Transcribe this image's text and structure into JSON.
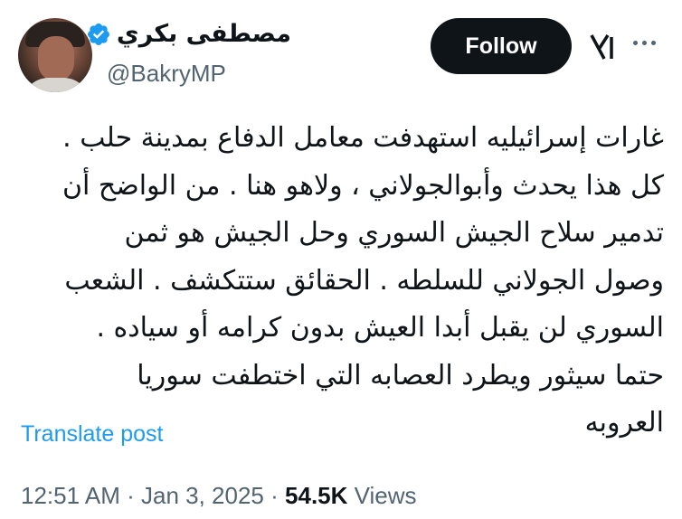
{
  "author": {
    "name": "مصطفى بكري",
    "handle": "@BakryMP",
    "verified_color": "#1d9bf0"
  },
  "header": {
    "follow_label": "Follow",
    "grok_icon": "grok-icon",
    "more_icon": "more-icon"
  },
  "tweet": {
    "lines": [
      "غارات إسرائيليه استهدفت معامل الدفاع بمدينة حلب .",
      "كل هذا يحدث وأبوالجولاني ، ولاهو هنا . من الواضح أن",
      "تدمير سلاح الجيش السوري وحل الجيش هو ثمن",
      "وصول الجولاني للسلطه . الحقائق ستتكشف . الشعب",
      "السوري لن يقبل أبدا العيش بدون كرامه أو سياده .",
      "حتما سيثور ويطرد العصابه التي اختطفت سوريا",
      "العروبه"
    ],
    "translate_label": "Translate post"
  },
  "meta": {
    "time": "12:51 AM",
    "date": "Jan 3, 2025",
    "views_count": "54.5K",
    "views_label": "Views",
    "separator": "·"
  }
}
